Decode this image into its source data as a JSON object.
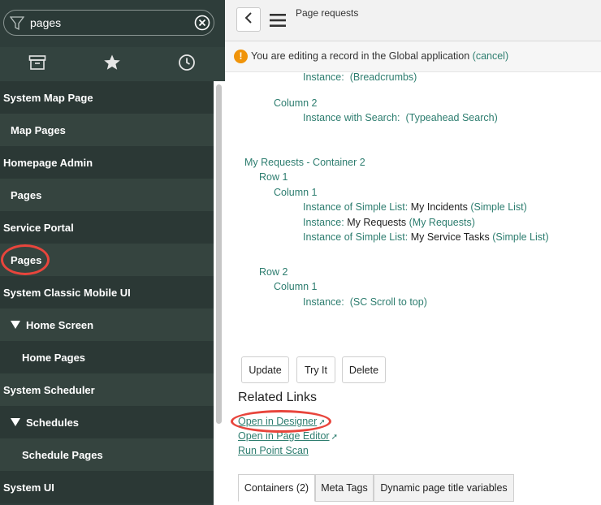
{
  "navigator": {
    "filter_value": "pages",
    "tabs": [
      {
        "icon": "archive-icon"
      },
      {
        "icon": "star-icon"
      },
      {
        "icon": "clock-icon"
      }
    ],
    "items": [
      {
        "label": "System Map Page",
        "level": 0
      },
      {
        "label": "Map Pages",
        "level": 1
      },
      {
        "label": "Homepage Admin",
        "level": 0
      },
      {
        "label": "Pages",
        "level": 1
      },
      {
        "label": "Service Portal",
        "level": 0
      },
      {
        "label": "Pages",
        "level": 1,
        "highlighted": true
      },
      {
        "label": "System Classic Mobile UI",
        "level": 0
      },
      {
        "label": "Home Screen",
        "level": 2,
        "expanded": true
      },
      {
        "label": "Home Pages",
        "level": 3
      },
      {
        "label": "System Scheduler",
        "level": 0
      },
      {
        "label": "Schedules",
        "level": 2,
        "expanded": true
      },
      {
        "label": "Schedule Pages",
        "level": 3
      },
      {
        "label": "System UI",
        "level": 0
      }
    ]
  },
  "header": {
    "title": "Page requests"
  },
  "info_bar": {
    "prefix": "You are editing a record in the ",
    "scope": "Global",
    "suffix": " application ",
    "cancel_label": "(cancel)"
  },
  "tree": {
    "breadcrumbs_line": {
      "label": "Instance:",
      "ref": "(Breadcrumbs)"
    },
    "column2_label": "Column 2",
    "search_line": {
      "label": "Instance with Search:",
      "ref": "(Typeahead Search)"
    },
    "container2_label": "My Requests - Container 2",
    "row1_label": "Row 1",
    "row1_column1_label": "Column 1",
    "row1_instances": [
      {
        "label": "Instance of Simple List:",
        "title": " My Incidents ",
        "ref": "(Simple List)"
      },
      {
        "label": "Instance:",
        "title": " My Requests ",
        "ref": "(My Requests)"
      },
      {
        "label": "Instance of Simple List:",
        "title": " My Service Tasks ",
        "ref": "(Simple List)"
      }
    ],
    "row2_label": "Row 2",
    "row2_column1_label": "Column 1",
    "row2_instance": {
      "label": "Instance:",
      "ref": "(SC Scroll to top)"
    }
  },
  "buttons": {
    "update": "Update",
    "try_it": "Try It",
    "delete": "Delete"
  },
  "related_links": {
    "heading": "Related Links",
    "open_in_designer": "Open in Designer",
    "open_in_page_editor": "Open in Page Editor",
    "run_point_scan": "Run Point Scan"
  },
  "related_tabs": [
    {
      "label": "Containers (2)",
      "active": true
    },
    {
      "label": "Meta Tags",
      "active": false
    },
    {
      "label": "Dynamic page title variables",
      "active": false
    }
  ],
  "colors": {
    "nav_bg": "#2e3d3a",
    "link": "#2d7d6f",
    "highlight_circle": "#e8453c",
    "warning": "#f0940a"
  }
}
